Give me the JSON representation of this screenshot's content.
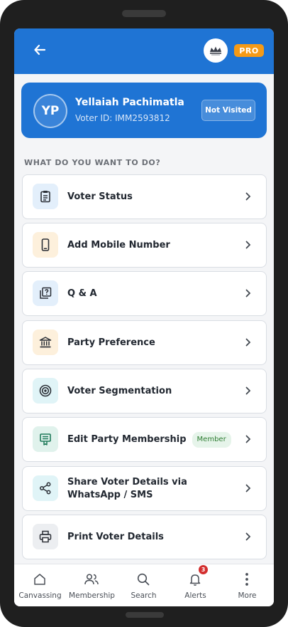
{
  "header": {
    "back_icon": "arrow-left-icon",
    "pro_label": "PRO",
    "brand_color": "#1f74d4",
    "pro_color": "#f59a16"
  },
  "voter": {
    "initials": "YP",
    "name": "Yellaiah Pachimatla",
    "voter_id": "Voter ID: IMM2593812",
    "status": "Not Visited"
  },
  "section_title": "WHAT DO YOU WANT TO DO?",
  "actions": [
    {
      "label": "Voter Status",
      "icon": "clipboard-icon",
      "icon_bg": "#e3effb"
    },
    {
      "label": "Add Mobile Number",
      "icon": "mobile-phone-icon",
      "icon_bg": "#fdf0dc"
    },
    {
      "label": "Q & A",
      "icon": "question-box-icon",
      "icon_bg": "#e3effb"
    },
    {
      "label": "Party Preference",
      "icon": "bank-building-icon",
      "icon_bg": "#fdf0dc"
    },
    {
      "label": "Voter Segmentation",
      "icon": "target-icon",
      "icon_bg": "#e0f4f7"
    },
    {
      "label": "Edit Party Membership",
      "icon": "membership-card-icon",
      "icon_bg": "#e0f2ec",
      "badge": "Member"
    },
    {
      "label": "Share Voter Details via WhatsApp / SMS",
      "icon": "share-icon",
      "icon_bg": "#e0f4f7"
    },
    {
      "label": "Print Voter Details",
      "icon": "printer-icon",
      "icon_bg": "#eceef1"
    }
  ],
  "nav": [
    {
      "label": "Canvassing",
      "icon": "home-icon"
    },
    {
      "label": "Membership",
      "icon": "users-icon"
    },
    {
      "label": "Search",
      "icon": "search-icon"
    },
    {
      "label": "Alerts",
      "icon": "bell-icon",
      "count": "3"
    },
    {
      "label": "More",
      "icon": "more-vertical-icon"
    }
  ]
}
